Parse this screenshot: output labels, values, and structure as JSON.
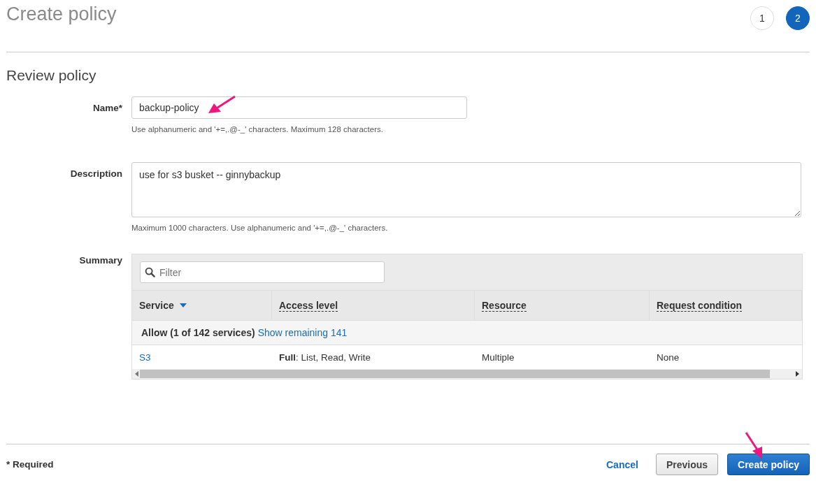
{
  "title": "Create policy",
  "steps": [
    {
      "label": "1",
      "selected": false
    },
    {
      "label": "2",
      "selected": true
    }
  ],
  "section_title": "Review policy",
  "name_field": {
    "label": "Name*",
    "value": "backup-policy",
    "hint": "Use alphanumeric and '+=,.@-_' characters. Maximum 128 characters."
  },
  "description_field": {
    "label": "Description",
    "value": "use for s3 busket -- ginnybackup",
    "hint": "Maximum 1000 characters. Use alphanumeric and '+=,.@-_' characters."
  },
  "summary": {
    "label": "Summary",
    "filter_placeholder": "Filter",
    "columns": [
      {
        "label": "Service",
        "sorted": true
      },
      {
        "label": "Access level",
        "sorted": false
      },
      {
        "label": "Resource",
        "sorted": false
      },
      {
        "label": "Request condition",
        "sorted": false
      }
    ],
    "group": {
      "label": "Allow (1 of 142 services)",
      "link": "Show remaining 141"
    },
    "rows": [
      {
        "service": "S3",
        "access": "**Full**: List, Read, Write",
        "resource": "Multiple",
        "condition": "None"
      }
    ]
  },
  "footer": {
    "required_note": "* Required",
    "cancel": "Cancel",
    "previous": "Previous",
    "create": "Create policy"
  }
}
